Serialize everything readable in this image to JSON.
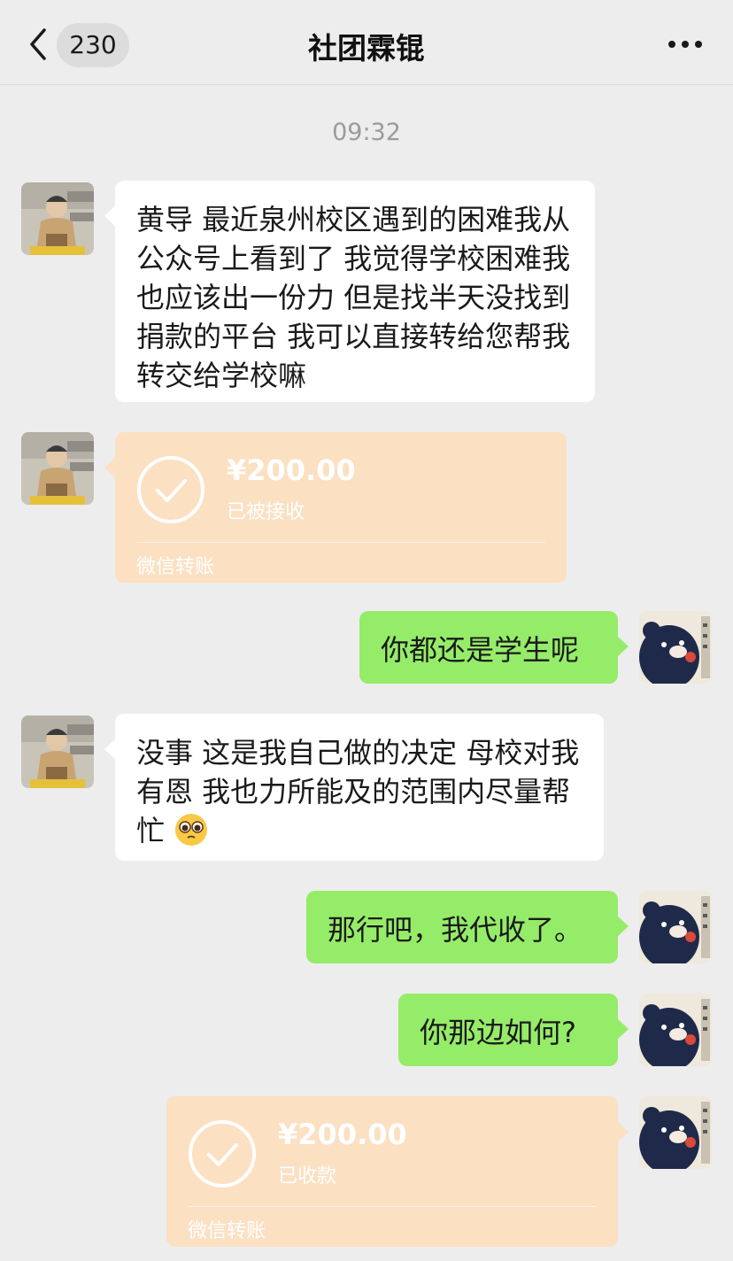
{
  "header": {
    "back_icon": "chevron-left-icon",
    "unread_count": "230",
    "title": "社团霖锟",
    "more_icon": "more-dots-icon"
  },
  "timestamp": "09:32",
  "messages": [
    {
      "side": "in",
      "type": "text",
      "text": "黄导 最近泉州校区遇到的困难我从公众号上看到了 我觉得学校困难我也应该出一份力 但是找半天没找到捐款的平台 我可以直接转给您帮我转交给学校嘛"
    },
    {
      "side": "in",
      "type": "transfer",
      "amount": "¥200.00",
      "status": "已被接收",
      "label": "微信转账"
    },
    {
      "side": "out",
      "type": "text",
      "text": "你都还是学生呢"
    },
    {
      "side": "in",
      "type": "text",
      "text": "没事 这是我自己做的决定 母校对我有恩 我也力所能及的范围内尽量帮忙",
      "emoji": "pleading-face-emoji"
    },
    {
      "side": "out",
      "type": "text",
      "text": "那行吧，我代收了。"
    },
    {
      "side": "out",
      "type": "text",
      "text": "你那边如何?"
    },
    {
      "side": "out",
      "type": "transfer",
      "amount": "¥200.00",
      "status": "已收款",
      "label": "微信转账"
    }
  ],
  "colors": {
    "background": "#ededed",
    "incoming_bubble": "#ffffff",
    "outgoing_bubble": "#95ec69",
    "transfer_card": "#fbe0c2",
    "timestamp": "#9b9b9b"
  }
}
